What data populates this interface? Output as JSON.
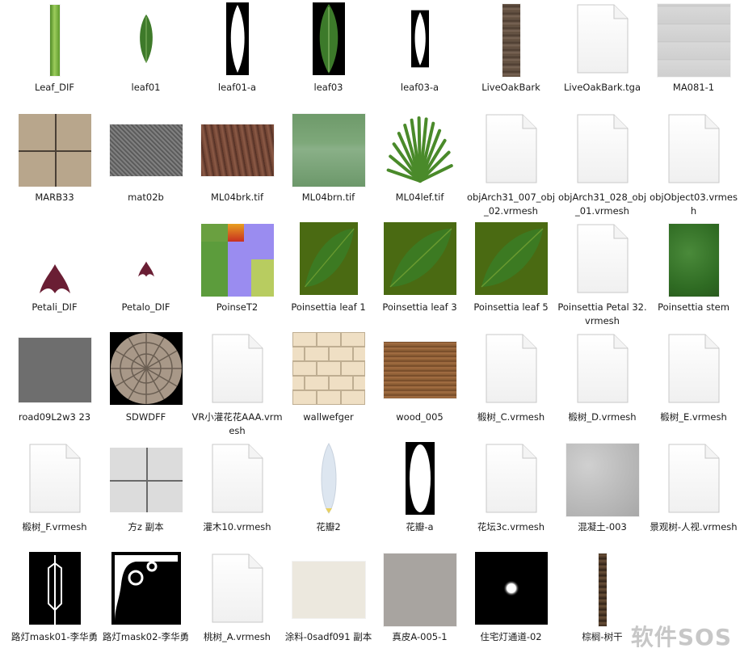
{
  "files": [
    {
      "label": "Leaf_DIF",
      "icon": "leaf-strip-thumbnail",
      "thumb": {
        "kind": "swatch",
        "w": 12,
        "h": 88,
        "bg": "linear-gradient(90deg,#4e8a24 0%,#9ccc5c 45%,#5e9a2c 100%)"
      }
    },
    {
      "label": "leaf01",
      "icon": "leaf-thumbnail",
      "thumb": {
        "kind": "leaf",
        "w": 28,
        "h": 90,
        "fill": "#3e7a2a",
        "vein": "#a8d080",
        "bg": "#ffffff"
      }
    },
    {
      "label": "leaf01-a",
      "icon": "leaf-alpha-mask-thumbnail",
      "thumb": {
        "kind": "mask-leaf",
        "w": 28,
        "h": 90,
        "fill": "#ffffff",
        "bg": "#000000"
      }
    },
    {
      "label": "leaf03",
      "icon": "leaf-thumbnail",
      "thumb": {
        "kind": "leaf",
        "w": 40,
        "h": 90,
        "fill": "#3c7a2a",
        "vein": "#9cc878",
        "bg": "#000000"
      }
    },
    {
      "label": "leaf03-a",
      "icon": "leaf-alpha-mask-thumbnail",
      "thumb": {
        "kind": "mask-leaf",
        "w": 22,
        "h": 88,
        "fill": "#ffffff",
        "bg": "#000000"
      }
    },
    {
      "label": "LiveOakBark",
      "icon": "bark-thumbnail",
      "thumb": {
        "kind": "swatch",
        "w": 22,
        "h": 90,
        "bg": "repeating-linear-gradient(0deg,#5c4a3a 0px,#7a6656 3px,#4c3c30 6px,#6a5848 9px)"
      }
    },
    {
      "label": "LiveOakBark.tga",
      "icon": "document-icon",
      "thumb": {
        "kind": "doc"
      }
    },
    {
      "label": "MA081-1",
      "icon": "marble-tile-thumbnail",
      "thumb": {
        "kind": "swatch",
        "w": 90,
        "h": 90,
        "bg": "repeating-linear-gradient(0deg,#cfcfcf 0px,#d8d8d8 20px,#c4c4c4 22px),#d0d0d0"
      }
    },
    {
      "label": "MARB33",
      "icon": "stone-tile-thumbnail",
      "thumb": {
        "kind": "tiles",
        "w": 90,
        "h": 90,
        "bg": "#b8a68c",
        "line": "#4a4036"
      }
    },
    {
      "label": "mat02b",
      "icon": "gravel-texture-thumbnail",
      "thumb": {
        "kind": "swatch",
        "w": 90,
        "h": 64,
        "bg": "repeating-linear-gradient(45deg,#5a5a5a 0px,#8a8a8a 2px,#4a4a4a 4px),#666666"
      }
    },
    {
      "label": "ML04brk.tif",
      "icon": "bark-texture-thumbnail",
      "thumb": {
        "kind": "swatch",
        "w": 90,
        "h": 64,
        "bg": "repeating-linear-gradient(80deg,#6a3e2e 0px,#8c5a46 4px,#4e2c22 8px),#6a3e2e"
      }
    },
    {
      "label": "ML04brn.tif",
      "icon": "green-texture-thumbnail",
      "thumb": {
        "kind": "swatch",
        "w": 90,
        "h": 90,
        "bg": "linear-gradient(180deg,#6e9a6a 0%,#7ea87a 40%,#8ab088 48%,#6c986a 100%)"
      }
    },
    {
      "label": "ML04lef.tif",
      "icon": "palm-frond-thumbnail",
      "thumb": {
        "kind": "palm",
        "w": 90,
        "h": 90
      }
    },
    {
      "label": "objArch31_007_obj_02.vrmesh",
      "icon": "document-icon",
      "thumb": {
        "kind": "doc"
      }
    },
    {
      "label": "objArch31_028_obj_01.vrmesh",
      "icon": "document-icon",
      "thumb": {
        "kind": "doc"
      }
    },
    {
      "label": "objObject03.vrmesh",
      "icon": "document-icon",
      "thumb": {
        "kind": "doc"
      }
    },
    {
      "label": "Petali_DIF",
      "icon": "petal-thumbnail",
      "thumb": {
        "kind": "petal",
        "w": 46,
        "h": 90
      }
    },
    {
      "label": "Petalo_DIF",
      "icon": "petal-thumbnail",
      "thumb": {
        "kind": "petal",
        "w": 24,
        "h": 90
      }
    },
    {
      "label": "PoinseT2",
      "icon": "texture-atlas-thumbnail",
      "thumb": {
        "kind": "atlas",
        "w": 90,
        "h": 90
      }
    },
    {
      "label": "Poinsettia leaf 1",
      "icon": "leaf-texture-thumbnail",
      "thumb": {
        "kind": "leafsq",
        "w": 72,
        "h": 90,
        "bg": "#4a6a12"
      }
    },
    {
      "label": "Poinsettia leaf 3",
      "icon": "leaf-texture-thumbnail",
      "thumb": {
        "kind": "leafsq",
        "w": 90,
        "h": 90,
        "bg": "#4a6a12"
      }
    },
    {
      "label": "Poinsettia leaf 5",
      "icon": "leaf-texture-thumbnail",
      "thumb": {
        "kind": "leafsq",
        "w": 90,
        "h": 90,
        "bg": "#4a6a12"
      }
    },
    {
      "label": "Poinsettia Petal 32.vrmesh",
      "icon": "document-icon",
      "thumb": {
        "kind": "doc"
      }
    },
    {
      "label": "Poinsettia stem",
      "icon": "green-texture-thumbnail",
      "thumb": {
        "kind": "swatch",
        "w": 62,
        "h": 90,
        "bg": "radial-gradient(circle at 40% 40%,#4a8a3a 0%,#2e6a22 70%,#2a5a1e 100%)"
      }
    },
    {
      "label": "road09L2w3 23",
      "icon": "asphalt-texture-thumbnail",
      "thumb": {
        "kind": "swatch",
        "w": 90,
        "h": 80,
        "bg": "#6e6e6e"
      }
    },
    {
      "label": "SDWDFF",
      "icon": "round-paving-thumbnail",
      "thumb": {
        "kind": "round",
        "w": 90,
        "h": 90
      }
    },
    {
      "label": "VR小灌花花AAA.vrmesh",
      "icon": "document-icon",
      "thumb": {
        "kind": "doc"
      }
    },
    {
      "label": "wallwefger",
      "icon": "brick-wall-thumbnail",
      "thumb": {
        "kind": "bricks",
        "w": 90,
        "h": 90
      }
    },
    {
      "label": "wood_005",
      "icon": "wood-texture-thumbnail",
      "thumb": {
        "kind": "swatch",
        "w": 90,
        "h": 70,
        "bg": "repeating-linear-gradient(0deg,#8a5a32 0px,#a87446 2px,#6e4424 4px,#9a6a3e 6px)"
      }
    },
    {
      "label": "椴树_C.vrmesh",
      "icon": "document-icon",
      "thumb": {
        "kind": "doc"
      }
    },
    {
      "label": "椴树_D.vrmesh",
      "icon": "document-icon",
      "thumb": {
        "kind": "doc"
      }
    },
    {
      "label": "椴树_E.vrmesh",
      "icon": "document-icon",
      "thumb": {
        "kind": "doc"
      }
    },
    {
      "label": "椴树_F.vrmesh",
      "icon": "document-icon",
      "thumb": {
        "kind": "doc"
      }
    },
    {
      "label": "方z 副本",
      "icon": "stone-tile-thumbnail",
      "thumb": {
        "kind": "tiles",
        "w": 90,
        "h": 80,
        "bg": "#dcdcdc",
        "line": "#6a6a6a"
      }
    },
    {
      "label": "灌木10.vrmesh",
      "icon": "document-icon",
      "thumb": {
        "kind": "doc"
      }
    },
    {
      "label": "花瓣2",
      "icon": "petal-thumbnail",
      "thumb": {
        "kind": "petal2",
        "w": 28,
        "h": 90
      }
    },
    {
      "label": "花瓣-a",
      "icon": "petal-alpha-mask-thumbnail",
      "thumb": {
        "kind": "oval",
        "w": 36,
        "h": 90
      }
    },
    {
      "label": "花坛3c.vrmesh",
      "icon": "document-icon",
      "thumb": {
        "kind": "doc"
      }
    },
    {
      "label": "混凝土-003",
      "icon": "concrete-texture-thumbnail",
      "thumb": {
        "kind": "swatch",
        "w": 90,
        "h": 90,
        "bg": "radial-gradient(circle at 30% 30%,#d0d0d0 0%,#b8b8b8 60%,#a8a8a8 100%)"
      }
    },
    {
      "label": "景观树-人视.vrmesh",
      "icon": "document-icon",
      "thumb": {
        "kind": "doc"
      }
    },
    {
      "label": "路灯mask01-李华勇",
      "icon": "lamp-mask-thumbnail",
      "thumb": {
        "kind": "lamp",
        "w": 64,
        "h": 90
      }
    },
    {
      "label": "路灯mask02-李华勇",
      "icon": "ornament-mask-thumbnail",
      "thumb": {
        "kind": "ornament",
        "w": 86,
        "h": 90
      }
    },
    {
      "label": "桃树_A.vrmesh",
      "icon": "document-icon",
      "thumb": {
        "kind": "doc"
      }
    },
    {
      "label": "涂料-0sadf091 副本",
      "icon": "paint-texture-thumbnail",
      "thumb": {
        "kind": "swatch",
        "w": 90,
        "h": 70,
        "bg": "#ece8de"
      }
    },
    {
      "label": "真皮A-005-1",
      "icon": "leather-texture-thumbnail",
      "thumb": {
        "kind": "swatch",
        "w": 90,
        "h": 90,
        "bg": "#a8a4a0"
      }
    },
    {
      "label": "住宅灯通道-02",
      "icon": "light-glow-thumbnail",
      "thumb": {
        "kind": "glow",
        "w": 90,
        "h": 90
      }
    },
    {
      "label": "棕榈-树干",
      "icon": "palm-trunk-thumbnail",
      "thumb": {
        "kind": "swatch",
        "w": 10,
        "h": 90,
        "bg": "repeating-linear-gradient(0deg,#3a2a1c 0px,#6a5038 4px,#2a1e14 7px)"
      }
    }
  ],
  "watermark": "软件SOS"
}
